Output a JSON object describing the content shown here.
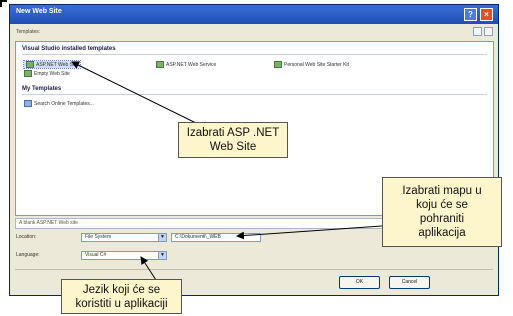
{
  "dialog": {
    "title": "New Web Site",
    "templates_label": "Templates:",
    "section_installed": "Visual Studio installed templates",
    "section_my": "My Templates",
    "items": [
      {
        "label": "ASP.NET Web Site",
        "icon": "website-icon"
      },
      {
        "label": "ASP.NET Web Service",
        "icon": "webservice-icon"
      },
      {
        "label": "Personal Web Site Starter Kit",
        "icon": "starter-kit-icon"
      },
      {
        "label": "Empty Web Site",
        "icon": "empty-website-icon"
      },
      {
        "label": "Search Online Templates...",
        "icon": "search-online-icon"
      }
    ],
    "description": "A blank ASP.NET Web site",
    "location_label": "Location:",
    "location_value": "File System",
    "path_value": "C:\\Dokumenti\\_WEB",
    "language_label": "Language:",
    "language_value": "Visual C#",
    "ok_label": "OK",
    "cancel_label": "Cancel"
  },
  "callouts": {
    "website": "Izabrati ASP .NET\nWeb Site",
    "folder": "Izabrati mapu u\nkoju će se\npohraniti\naplikacija",
    "language": "Jezik koji će se\nkoristiti u aplikaciji"
  },
  "colors": {
    "titlebar": "#2a5fc8",
    "callout_bg": "#fdf5cc",
    "dialog_bg": "#ece9d8"
  }
}
